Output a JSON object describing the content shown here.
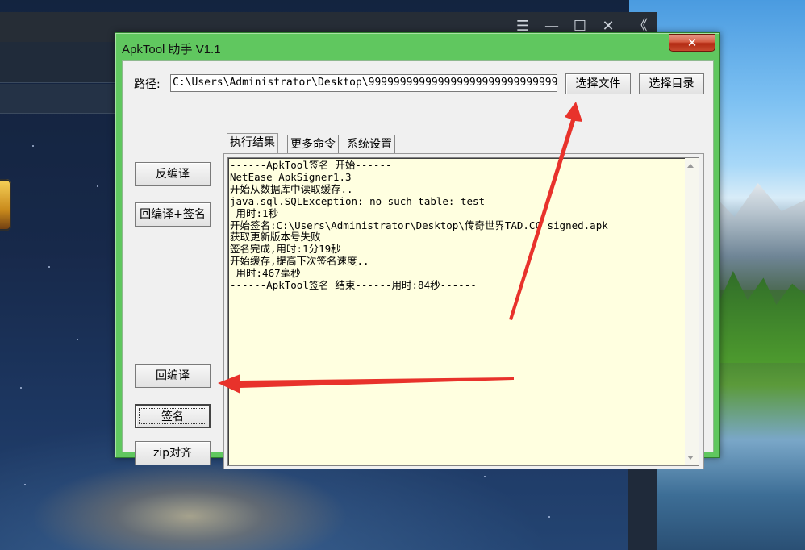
{
  "window": {
    "title": "ApkTool 助手 V1.1",
    "close_glyph": "✕"
  },
  "path": {
    "label": "路径:",
    "value": "C:\\Users\\Administrator\\Desktop\\999999999999999999999999999999"
  },
  "buttons": {
    "select_file": "选择文件",
    "select_dir": "选择目录",
    "decompile": "反编译",
    "recompile_sign": "回编译+签名",
    "recompile": "回编译",
    "sign": "签名",
    "zipalign": "zip对齐"
  },
  "tabs": {
    "results": "执行结果",
    "more": "更多命令",
    "settings": "系统设置"
  },
  "log": {
    "lines": [
      "------ApkTool签名 开始------",
      "NetEase ApkSigner1.3",
      "开始从数据库中读取缓存..",
      "java.sql.SQLException: no such table: test",
      " 用时:1秒",
      "开始签名:C:\\Users\\Administrator\\Desktop\\传奇世界TAD.CC_signed.apk",
      "获取更新版本号失败",
      "签名完成,用时:1分19秒",
      "开始缓存,提高下次签名速度..",
      " 用时:467毫秒",
      "------ApkTool签名 结束------用时:84秒------"
    ]
  },
  "background_app": {
    "controls": [
      "☰",
      "—",
      "☐",
      "✕",
      "《"
    ]
  },
  "colors": {
    "window_frame": "#60c75f",
    "log_background": "#ffffe0",
    "annotation_arrow": "#e8322b"
  }
}
